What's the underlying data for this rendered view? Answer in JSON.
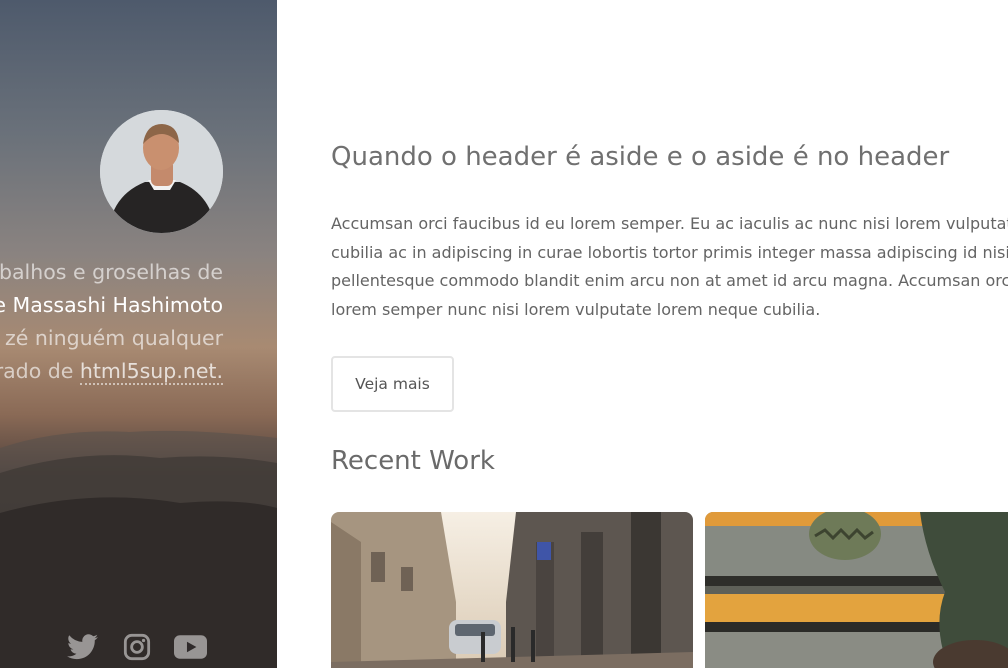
{
  "sidebar": {
    "intro": {
      "line1": "balhos e groselhas de",
      "name": "e Massashi Hashimoto",
      "line3": "zé ninguém qualquer",
      "line4_prefix": "rado de ",
      "link": "html5sup.net."
    },
    "social": [
      {
        "icon": "twitter-icon"
      },
      {
        "icon": "instagram-icon"
      },
      {
        "icon": "youtube-icon"
      }
    ]
  },
  "main": {
    "title": "Quando o header é aside e o aside é no header",
    "intro_lines": [
      "Accumsan orci faucibus id eu lorem semper. Eu ac iaculis ac nunc nisi lorem vulputate lorem",
      "cubilia ac in adipiscing in curae lobortis tortor primis integer massa adipiscing id nisi accumsan",
      "pellentesque commodo blandit enim arcu non at amet id arcu magna. Accumsan orci faucibus id eu",
      "lorem semper nunc nisi lorem vulputate lorem neque cubilia."
    ],
    "more_button": "Veja mais",
    "recent_work_title": "Recent Work"
  },
  "colors": {
    "text": "#646464",
    "heading": "#707070",
    "button_border": "#e4e4e4"
  }
}
